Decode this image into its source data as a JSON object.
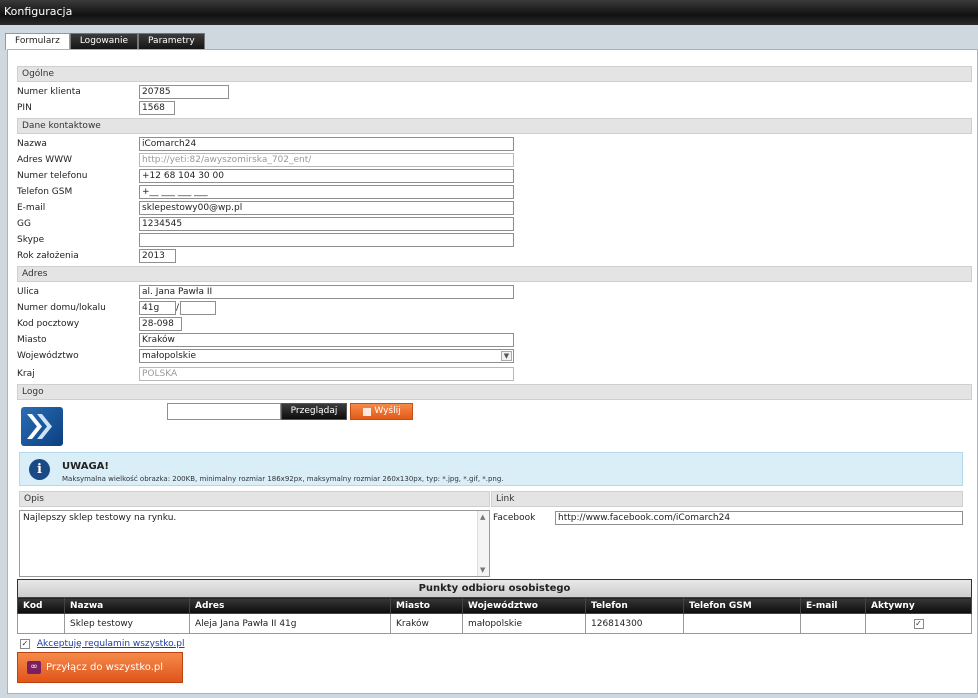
{
  "window": {
    "title": "Konfiguracja"
  },
  "tabs": [
    {
      "label": "Formularz",
      "active": true
    },
    {
      "label": "Logowanie",
      "active": false
    },
    {
      "label": "Parametry",
      "active": false
    }
  ],
  "sections": {
    "general": "Ogólne",
    "contact": "Dane kontaktowe",
    "address": "Adres",
    "logo": "Logo",
    "description": "Opis",
    "link": "Link"
  },
  "general": {
    "client_number": {
      "label": "Numer klienta",
      "value": "20785"
    },
    "pin": {
      "label": "PIN",
      "value": "1568"
    }
  },
  "contact": {
    "name": {
      "label": "Nazwa",
      "value": "iComarch24"
    },
    "www": {
      "label": "Adres WWW",
      "value": "http://yeti:82/awyszomirska_702_ent/"
    },
    "phone": {
      "label": "Numer telefonu",
      "value": "+12 68 104 30 00"
    },
    "gsm": {
      "label": "Telefon GSM",
      "value": "+__ ___ ___ ___"
    },
    "email": {
      "label": "E-mail",
      "value": "sklepestowy00@wp.pl"
    },
    "gg": {
      "label": "GG",
      "value": "1234545"
    },
    "skype": {
      "label": "Skype",
      "value": ""
    },
    "founded": {
      "label": "Rok założenia",
      "value": "2013"
    }
  },
  "address": {
    "street": {
      "label": "Ulica",
      "value": "al. Jana Pawła II"
    },
    "house": {
      "label": "Numer domu/lokalu",
      "value": "41g",
      "local_value": ""
    },
    "postal": {
      "label": "Kod pocztowy",
      "value": "28-098"
    },
    "city": {
      "label": "Miasto",
      "value": "Kraków"
    },
    "voivodeship": {
      "label": "Województwo",
      "value": "małopolskie"
    },
    "country": {
      "label": "Kraj",
      "value": "POLSKA"
    }
  },
  "logo": {
    "browse_label": "Przeglądaj",
    "send_label": "Wyślij",
    "file_value": ""
  },
  "notice": {
    "title": "UWAGA!",
    "text": "Maksymalna wielkość obrazka: 200KB, minimalny rozmiar 186x92px, maksymalny rozmiar 260x130px, typ: *.jpg, *.gif, *.png."
  },
  "description": {
    "value": "Najlepszy sklep testowy na rynku."
  },
  "link": {
    "facebook": {
      "label": "Facebook",
      "value": "http://www.facebook.com/iComarch24"
    }
  },
  "pickup": {
    "title": "Punkty odbioru osobistego",
    "columns": [
      "Kod",
      "Nazwa",
      "Adres",
      "Miasto",
      "Województwo",
      "Telefon",
      "Telefon GSM",
      "E-mail",
      "Aktywny"
    ],
    "rows": [
      {
        "code": "",
        "name": "Sklep testowy",
        "address": "Aleja Jana Pawła II 41g",
        "city": "Kraków",
        "voivodeship": "małopolskie",
        "phone": "126814300",
        "gsm": "",
        "email": "",
        "active": "✓"
      }
    ]
  },
  "footer": {
    "accept_check": "✓",
    "accept_label": "Akceptuję regulamin wszystko.pl",
    "connect_label": "Przyłącz do wszystko.pl"
  },
  "colors": {
    "accent_orange": "#e45a17",
    "dark_header": "#151515",
    "notice_bg": "#d9eef7"
  }
}
